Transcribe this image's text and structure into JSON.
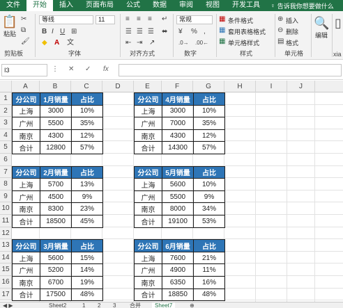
{
  "menu": {
    "items": [
      "文件",
      "开始",
      "插入",
      "页面布局",
      "公式",
      "数据",
      "审阅",
      "视图",
      "开发工具"
    ],
    "active_index": 1,
    "tell_me": "告诉我你想要做什么"
  },
  "ribbon": {
    "paste": "粘贴",
    "clipboard": "剪贴板",
    "font_name": "等线",
    "font_size": "11",
    "font": "字体",
    "align": "对齐方式",
    "number_format": "常规",
    "number": "数字",
    "cond_format": "条件格式",
    "table_format": "套用表格格式",
    "cell_style": "单元格样式",
    "styles": "样式",
    "insert": "插入",
    "delete": "删除",
    "format": "格式",
    "cells": "单元格",
    "edit": "编辑",
    "more": "xia"
  },
  "formula_bar": {
    "name_box": "I3",
    "fx": "fx"
  },
  "columns": [
    "A",
    "B",
    "C",
    "D",
    "E",
    "F",
    "G",
    "H",
    "I",
    "J"
  ],
  "rows": [
    "1",
    "2",
    "3",
    "4",
    "5",
    "6",
    "7",
    "8",
    "9",
    "10",
    "11",
    "12",
    "13",
    "14",
    "15",
    "16",
    "17"
  ],
  "tables": [
    {
      "header": [
        "分公司",
        "1月销量",
        "占比"
      ],
      "rows": [
        [
          "上海",
          "3000",
          "10%"
        ],
        [
          "广州",
          "5500",
          "35%"
        ],
        [
          "南京",
          "4300",
          "12%"
        ],
        [
          "合计",
          "12800",
          "57%"
        ]
      ]
    },
    {
      "header": [
        "分公司",
        "4月销量",
        "占比"
      ],
      "rows": [
        [
          "上海",
          "3000",
          "10%"
        ],
        [
          "广州",
          "7000",
          "35%"
        ],
        [
          "南京",
          "4300",
          "12%"
        ],
        [
          "合计",
          "14300",
          "57%"
        ]
      ]
    },
    {
      "header": [
        "分公司",
        "2月销量",
        "占比"
      ],
      "rows": [
        [
          "上海",
          "5700",
          "13%"
        ],
        [
          "广州",
          "4500",
          "9%"
        ],
        [
          "南京",
          "8300",
          "23%"
        ],
        [
          "合计",
          "18500",
          "45%"
        ]
      ]
    },
    {
      "header": [
        "分公司",
        "5月销量",
        "占比"
      ],
      "rows": [
        [
          "上海",
          "5600",
          "10%"
        ],
        [
          "广州",
          "5500",
          "9%"
        ],
        [
          "南京",
          "8000",
          "34%"
        ],
        [
          "合计",
          "19100",
          "53%"
        ]
      ]
    },
    {
      "header": [
        "分公司",
        "3月销量",
        "占比"
      ],
      "rows": [
        [
          "上海",
          "5600",
          "15%"
        ],
        [
          "广州",
          "5200",
          "14%"
        ],
        [
          "南京",
          "6700",
          "19%"
        ],
        [
          "合计",
          "17500",
          "48%"
        ]
      ]
    },
    {
      "header": [
        "分公司",
        "6月销量",
        "占比"
      ],
      "rows": [
        [
          "上海",
          "7600",
          "21%"
        ],
        [
          "广州",
          "4900",
          "11%"
        ],
        [
          "南京",
          "6350",
          "16%"
        ],
        [
          "合计",
          "18850",
          "48%"
        ]
      ]
    }
  ],
  "sheet_tabs": [
    "Sheet2",
    "1",
    "2",
    "3",
    "合并",
    "Sheet7"
  ],
  "active_sheet_index": 5,
  "colors": {
    "excel_green": "#217346",
    "table_header": "#2e75b6"
  }
}
